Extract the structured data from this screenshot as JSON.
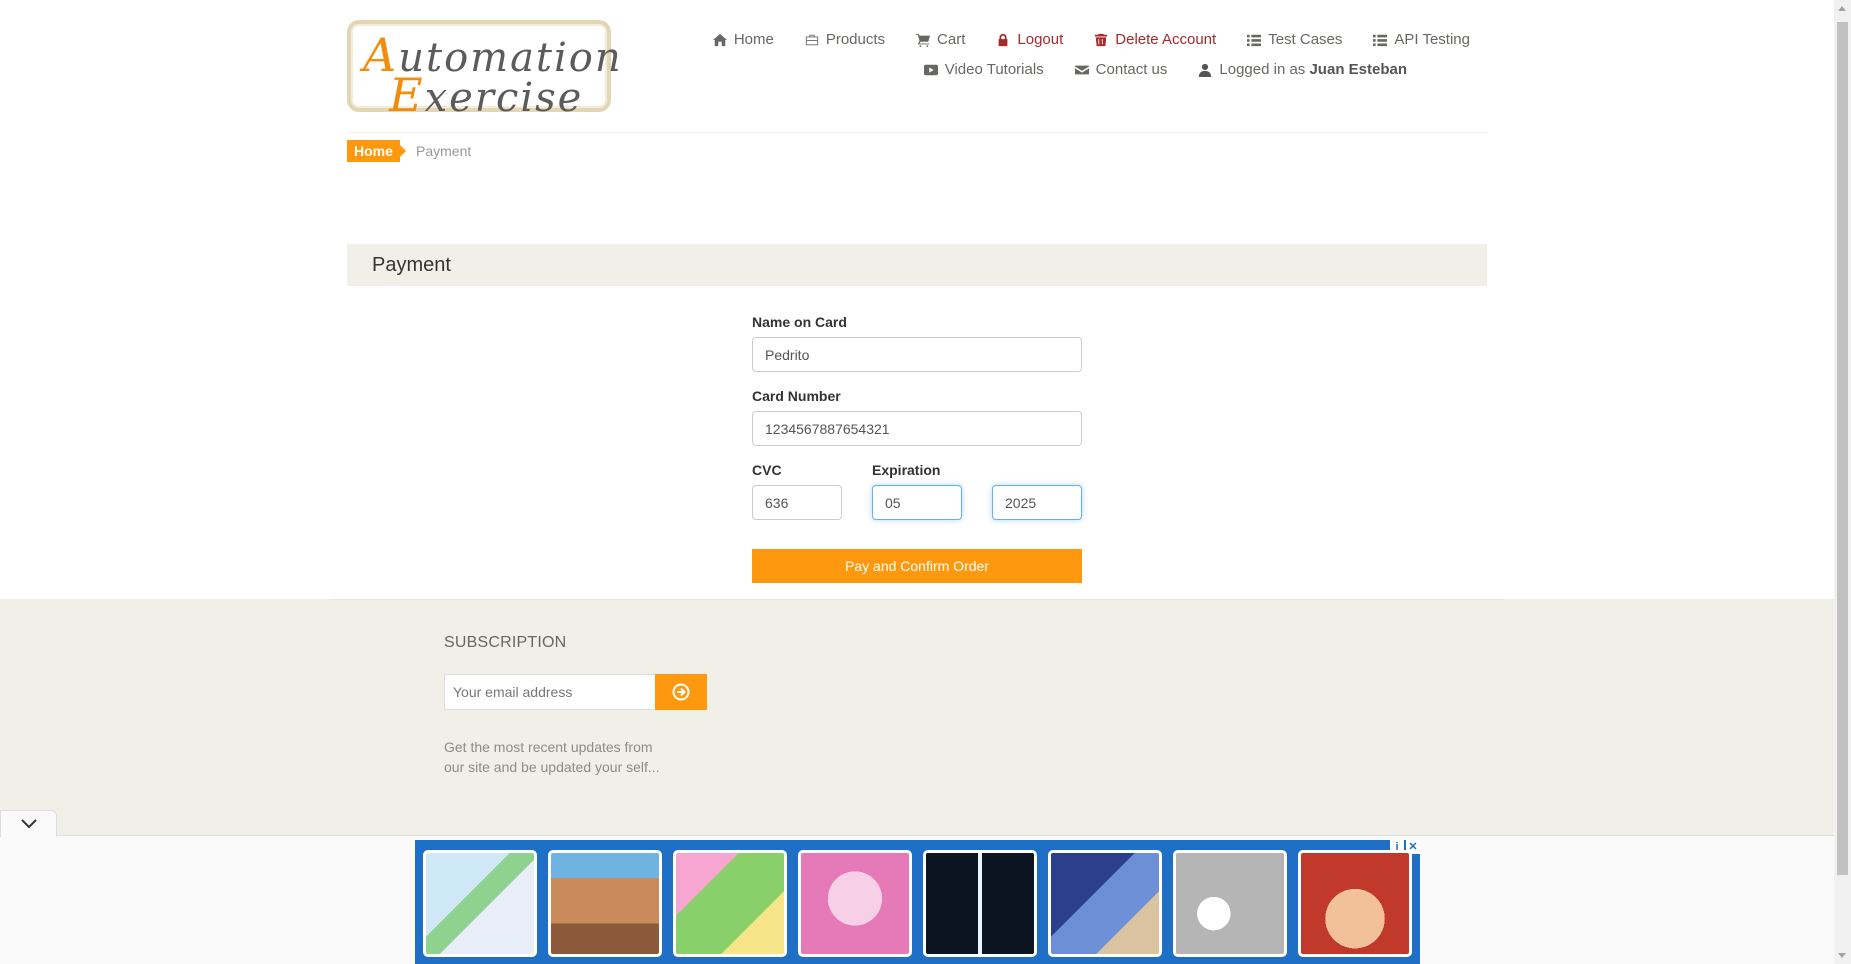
{
  "logo": {
    "line1_first": "A",
    "line1_rest": "utomation",
    "line2_first": "E",
    "line2_rest": "xercise"
  },
  "nav": {
    "home": "Home",
    "products": "Products",
    "cart": "Cart",
    "logout": "Logout",
    "delete_account": "Delete Account",
    "test_cases": "Test Cases",
    "api_testing": "API Testing",
    "video_tutorials": "Video Tutorials",
    "contact_us": "Contact us",
    "logged_in_prefix": "Logged in as",
    "logged_in_user": "Juan Esteban"
  },
  "breadcrumb": {
    "home": "Home",
    "current": "Payment"
  },
  "payment": {
    "heading": "Payment",
    "name_label": "Name on Card",
    "name_value": "Pedrito",
    "card_label": "Card Number",
    "card_value": "1234567887654321",
    "cvc_label": "CVC",
    "cvc_value": "636",
    "expiration_label": "Expiration",
    "exp_month_value": "05",
    "exp_year_value": "2025",
    "submit_label": "Pay and Confirm Order"
  },
  "subscription": {
    "title": "SUBSCRIPTION",
    "placeholder": "Your email address",
    "description": "Get the most recent updates from our site and be updated your self..."
  },
  "colors": {
    "accent": "#fe980f",
    "danger": "#a52a2a",
    "panel": "#f0f0e9",
    "ad_blue": "#1f6fc6"
  }
}
